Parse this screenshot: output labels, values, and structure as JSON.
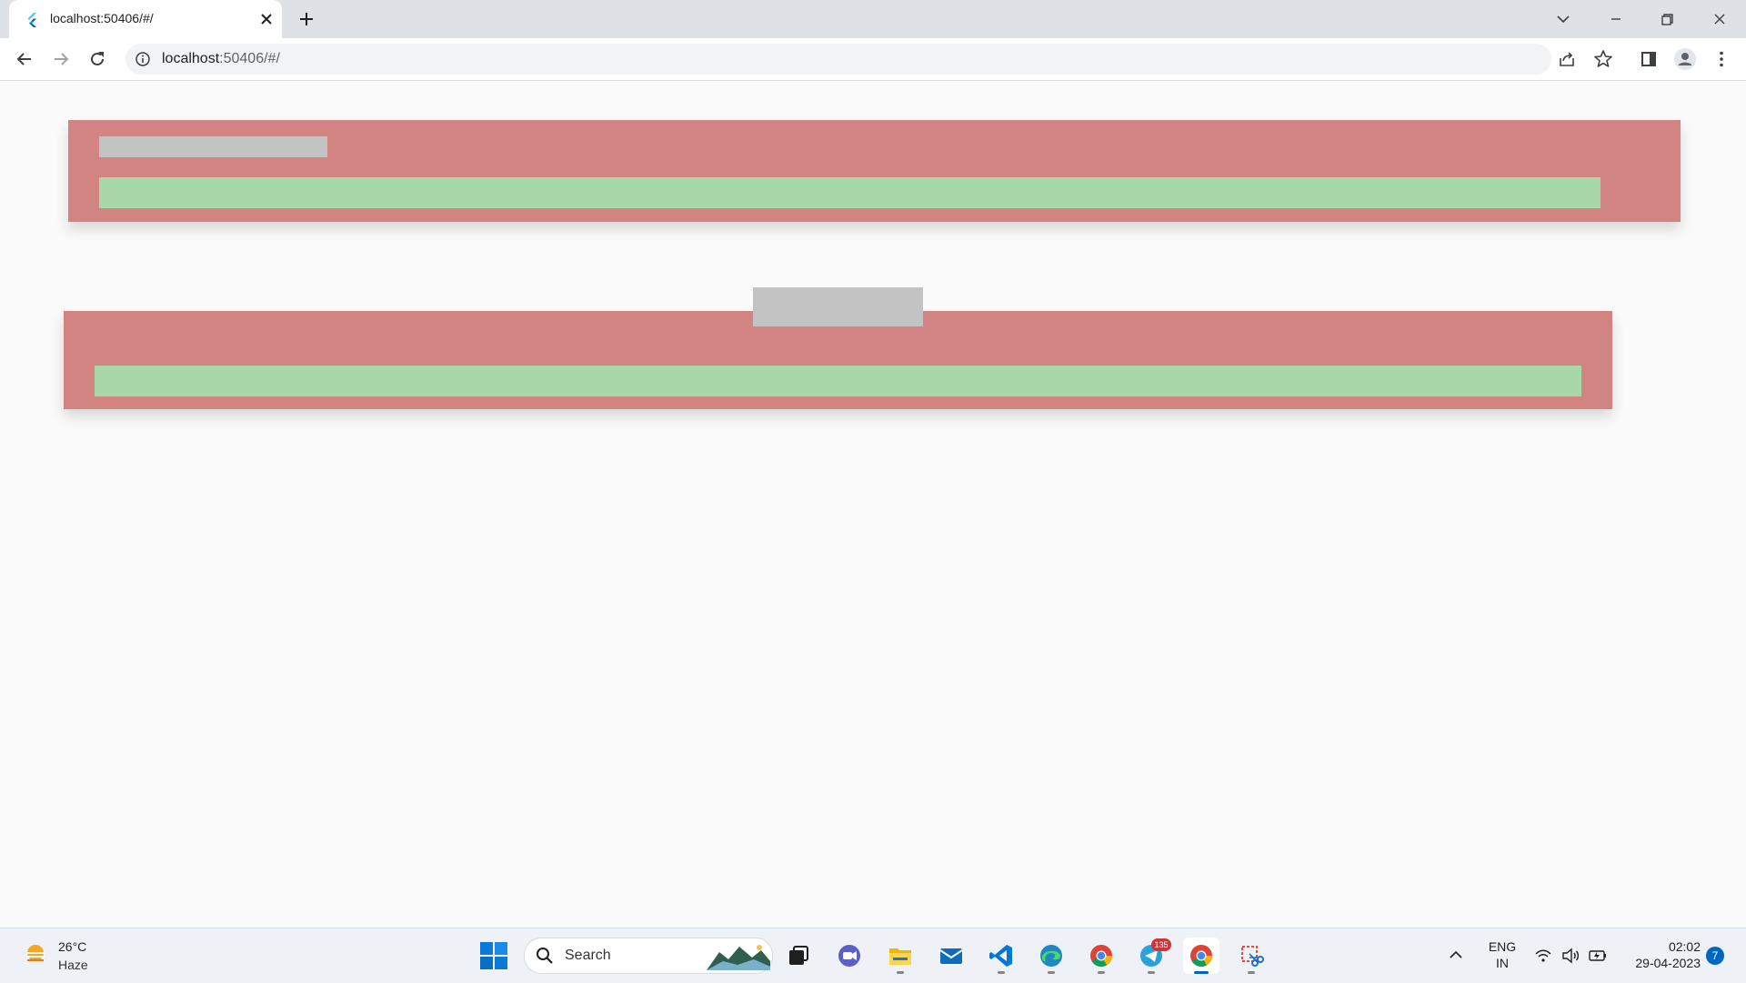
{
  "browser": {
    "tab_title": "localhost:50406/#/",
    "address_host": "localhost",
    "address_path": ":50406/#/",
    "icons": [
      "flutter-favicon",
      "close-icon",
      "plus-icon",
      "chevron-down-icon",
      "minimize-icon",
      "restore-icon",
      "window-close-icon",
      "back-icon",
      "forward-icon",
      "reload-icon",
      "info-icon",
      "share-icon",
      "star-icon",
      "side-panel-icon",
      "profile-icon",
      "more-icon"
    ]
  },
  "page": {
    "background": "#fafafa",
    "card_color": "#d28482",
    "placeholder_color": "#c3c3c3",
    "bar_color": "#a8d8a9"
  },
  "taskbar": {
    "weather_temp": "26°C",
    "weather_desc": "Haze",
    "search_label": "Search",
    "telegram_badge": "135",
    "lang_line1": "ENG",
    "lang_line2": "IN",
    "time": "02:02",
    "date": "29-04-2023",
    "notification_count": "7"
  }
}
